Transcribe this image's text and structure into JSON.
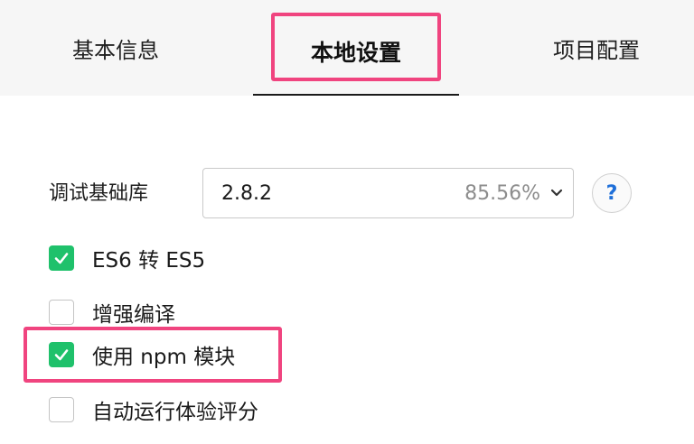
{
  "tabs": {
    "basic": "基本信息",
    "local": "本地设置",
    "project": "项目配置"
  },
  "debug_lib": {
    "label": "调试基础库",
    "value": "2.8.2",
    "percent": "85.56%",
    "help": "?"
  },
  "options": {
    "es6": {
      "label": "ES6 转 ES5",
      "checked": true
    },
    "enhance": {
      "label": "增强编译",
      "checked": false
    },
    "npm": {
      "label": "使用 npm 模块",
      "checked": true
    },
    "auto": {
      "label": "自动运行体验评分",
      "checked": false
    }
  },
  "colors": {
    "highlight": "#f0447f",
    "check_green": "#1fc16b",
    "help_blue": "#1e6fd9"
  }
}
